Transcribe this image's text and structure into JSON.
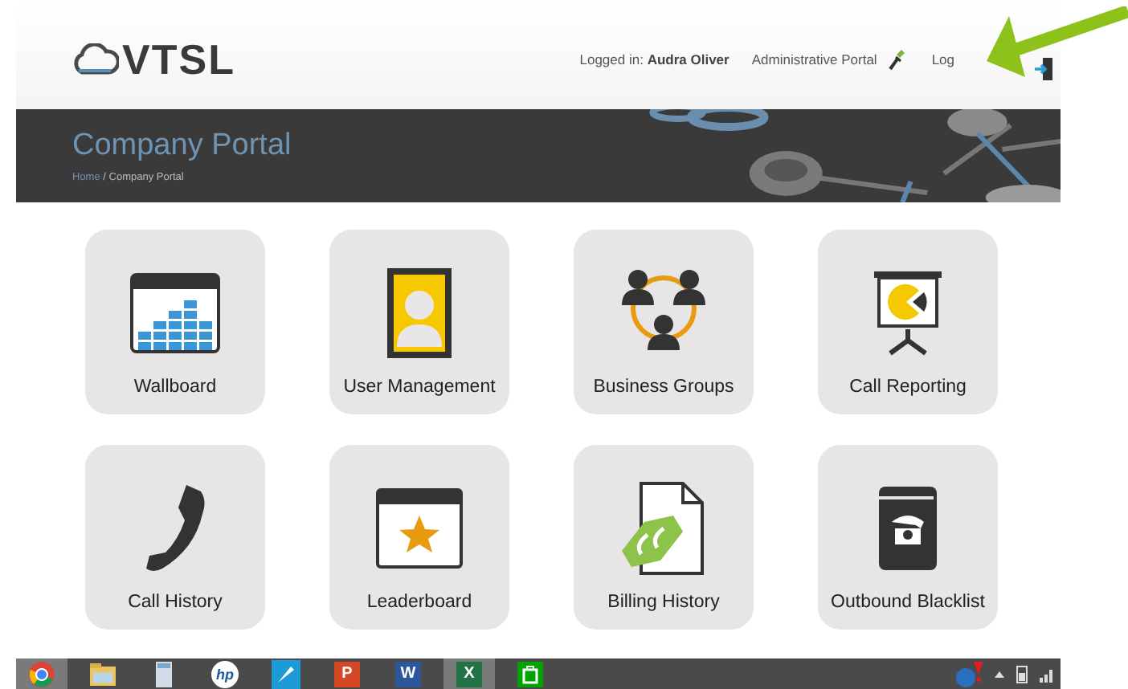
{
  "header": {
    "logo": "VTSL",
    "logged_in_label": "Logged in:",
    "user_name": "Audra Oliver",
    "admin_link": "Administrative Portal",
    "logout_link": "Log"
  },
  "banner": {
    "title": "Company Portal",
    "breadcrumb": [
      {
        "label": "Home",
        "link": true
      },
      {
        "label": " / Company Portal",
        "link": false
      }
    ]
  },
  "tiles": [
    {
      "kind": "wallboard",
      "label": "Wallboard"
    },
    {
      "kind": "user",
      "label": "User Management"
    },
    {
      "kind": "groups",
      "label": "Business Groups"
    },
    {
      "kind": "report",
      "label": "Call Reporting"
    },
    {
      "kind": "phone",
      "label": "Call History"
    },
    {
      "kind": "star",
      "label": "Leaderboard"
    },
    {
      "kind": "billing",
      "label": "Billing History"
    },
    {
      "kind": "book",
      "label": "Outbound Blacklist"
    }
  ],
  "taskbar": {
    "apps": [
      {
        "kind": "browser",
        "active": true
      },
      {
        "kind": "folder",
        "active": false
      },
      {
        "kind": "calculator",
        "active": false
      },
      {
        "kind": "hp",
        "label": "hp",
        "active": false
      },
      {
        "kind": "rocket",
        "active": false
      },
      {
        "kind": "powerpoint",
        "label": "P",
        "active": false
      },
      {
        "kind": "word",
        "label": "W",
        "active": false
      },
      {
        "kind": "excel",
        "label": "X",
        "active": true
      },
      {
        "kind": "store",
        "active": false
      }
    ]
  },
  "annotation": {
    "kind": "arrow"
  }
}
